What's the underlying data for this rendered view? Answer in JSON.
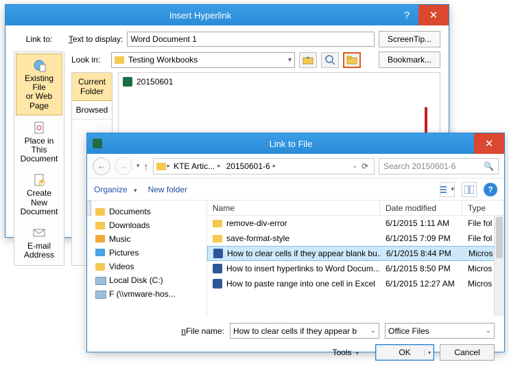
{
  "hyperlink": {
    "title": "Insert Hyperlink",
    "linkto_lbl": "Link to:",
    "text_to_display_lbl": "Text to display:",
    "text_to_display_val": "Word Document 1",
    "screentip_btn": "ScreenTip...",
    "bookmark_btn": "Bookmark...",
    "look_in_lbl": "Look in:",
    "look_in_val": "Testing Workbooks",
    "file_in_list": "20150601",
    "nav": {
      "existing": "Existing File\nor Web Page",
      "place": "Place in This\nDocument",
      "createnew": "Create New\nDocument",
      "email": "E-mail\nAddress"
    },
    "side": {
      "current": "Current\nFolder",
      "browsed": "Browsed"
    }
  },
  "linktofile": {
    "title": "Link to File",
    "crumbs": [
      "KTE Artic...",
      "20150601-6"
    ],
    "search_placeholder": "Search 20150601-6",
    "organize": "Organize",
    "newfolder": "New folder",
    "cols": {
      "name": "Name",
      "date": "Date modified",
      "type": "Type"
    },
    "tree": [
      "Documents",
      "Downloads",
      "Music",
      "Pictures",
      "Videos",
      "Local Disk (C:)",
      "F (\\\\vmware-hos..."
    ],
    "files": [
      {
        "item": "remove-div-error",
        "date": "6/1/2015 1:11 AM",
        "type": "File fol",
        "kind": "folder"
      },
      {
        "item": "save-format-style",
        "date": "6/1/2015 7:09 PM",
        "type": "File fol",
        "kind": "folder"
      },
      {
        "item": "How to clear cells if they appear blank bu...",
        "full": "How to clear cells if they appear blank but are not in Excel",
        "date": "6/1/2015 8:44 PM",
        "type": "Micros",
        "kind": "word",
        "selected": true
      },
      {
        "item": "How to insert hyperlinks to Word Docum...",
        "date": "6/1/2015 8:50 PM",
        "type": "Micros",
        "kind": "word"
      },
      {
        "item": "How to paste range into one cell in Excel",
        "date": "6/1/2015 12:27 AM",
        "type": "Micros",
        "kind": "word"
      }
    ],
    "filename_lbl": "File name:",
    "filename_val": "How to clear cells if they appear b",
    "filter": "Office Files",
    "tools": "Tools",
    "ok": "OK",
    "cancel": "Cancel",
    "help": "?"
  }
}
